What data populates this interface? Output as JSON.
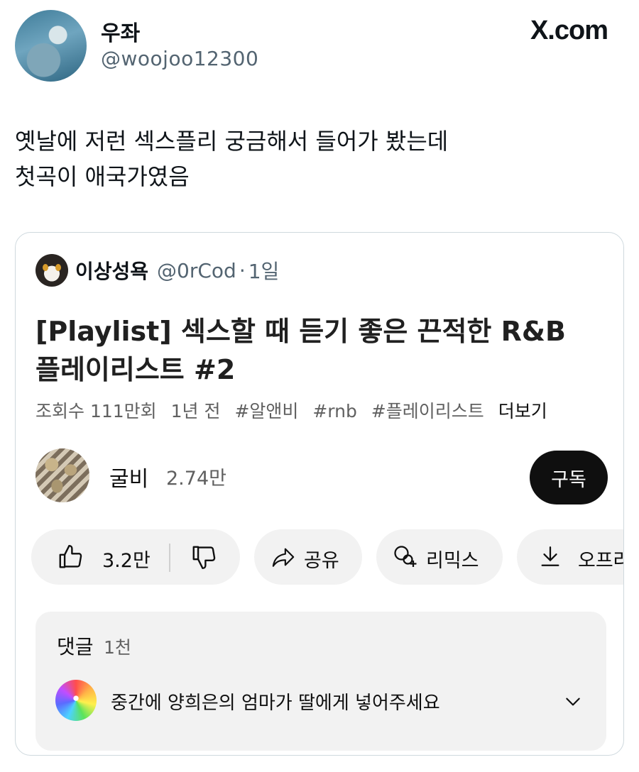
{
  "tweet": {
    "display_name": "우좌",
    "handle": "@woojoo12300",
    "brand": "X.com",
    "text_lines": [
      "옛날에 저런 섹스플리 궁금해서 들어가 봤는데",
      "첫곡이 애국가였음"
    ]
  },
  "quote": {
    "name": "이상성욕",
    "handle": "@0rCod",
    "separator": "·",
    "time": "1일"
  },
  "video": {
    "title_lines": [
      "[Playlist]  섹스할 때 듣기 좋은 끈적한 R&B",
      "플레이리스트 #2"
    ],
    "views": "조회수 111만회",
    "age": "1년 전",
    "tags": [
      "#알앤비",
      "#rnb",
      "#플레이리스트"
    ],
    "more_label": "더보기"
  },
  "channel": {
    "name": "굴비",
    "subscribers": "2.74만",
    "subscribe_label": "구독"
  },
  "actions": {
    "like_count": "3.2만",
    "share_label": "공유",
    "remix_label": "리믹스",
    "offline_label": "오프라인"
  },
  "comments": {
    "title": "댓글",
    "count": "1천",
    "top_comment": "중간에 양희은의 엄마가 딸에게 넣어주세요"
  },
  "icons": {
    "like": "thumbs-up-icon",
    "dislike": "thumbs-down-icon",
    "share": "share-arrow-icon",
    "remix": "remix-icon",
    "download": "download-icon",
    "expand": "chevron-down-icon"
  }
}
